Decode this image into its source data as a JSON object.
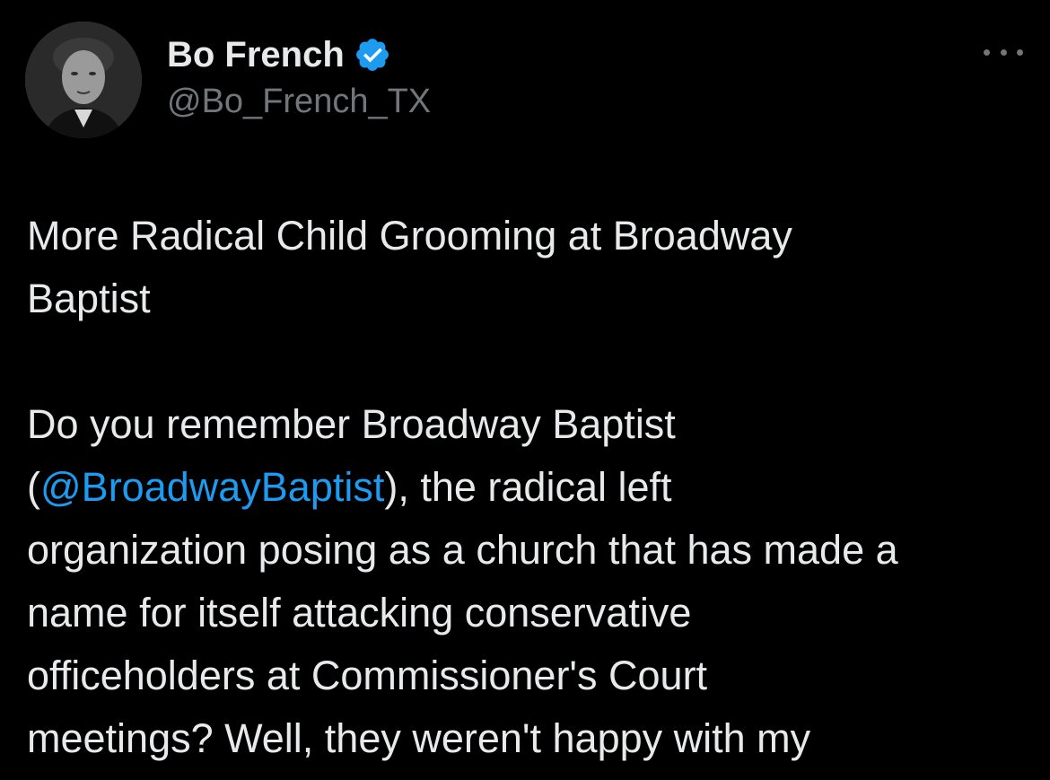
{
  "user": {
    "display_name": "Bo French",
    "handle": "@Bo_French_TX",
    "verified": true,
    "verified_color": "#1d9bf0",
    "avatar_icon": "profile-photo"
  },
  "more_icon": "ellipsis-icon",
  "tweet": {
    "title_lines": [
      "More Radical Child Grooming at Broadway",
      "Baptist"
    ],
    "body_line1": "Do you remember Broadway Baptist",
    "body_line2_pre": "(",
    "mention": "@BroadwayBaptist",
    "body_line2_post": "), the radical left",
    "body_lines_rest": [
      "organization posing as a church that has made a",
      "name for itself attacking conservative",
      "officeholders at Commissioner's Court",
      "meetings? Well, they weren't happy with my"
    ]
  },
  "colors": {
    "background": "#000000",
    "text": "#e7e9ea",
    "secondary": "#71767b",
    "link": "#1d9bf0"
  }
}
